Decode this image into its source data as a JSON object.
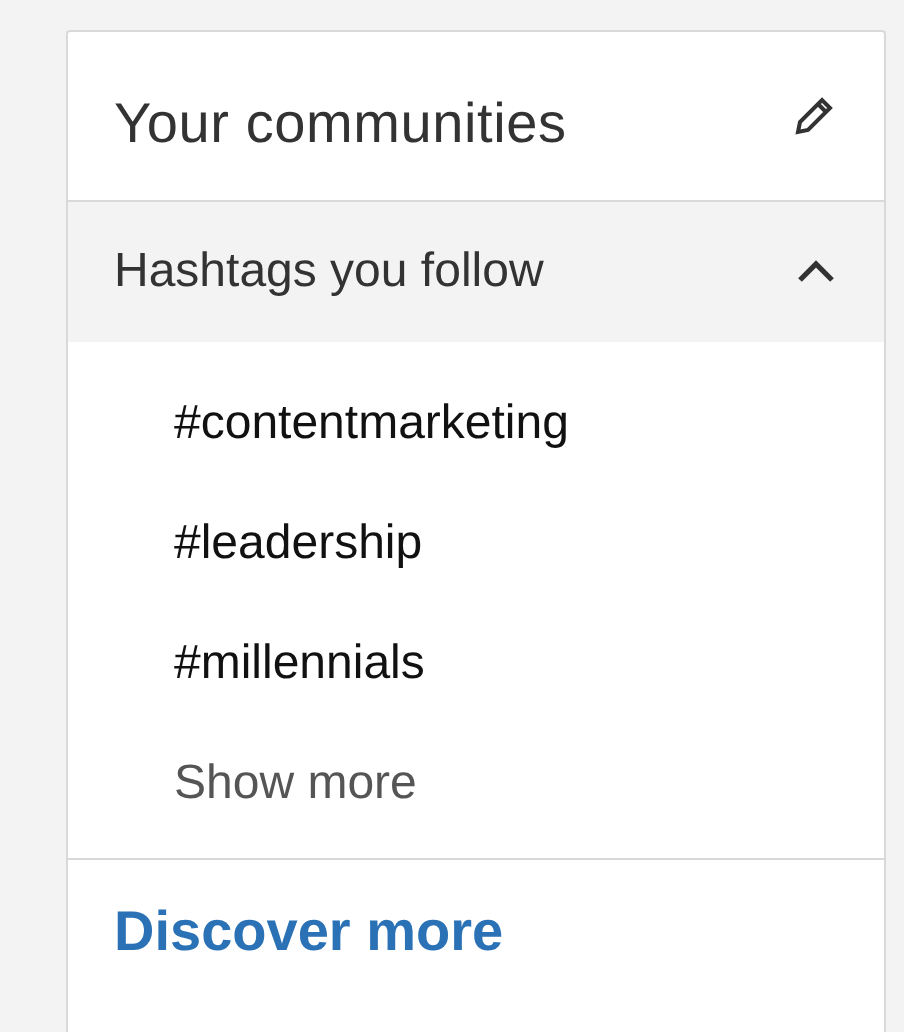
{
  "card": {
    "title": "Your communities"
  },
  "section": {
    "title": "Hashtags you follow",
    "expanded": true,
    "items": [
      {
        "label": "#contentmarketing"
      },
      {
        "label": "#leadership"
      },
      {
        "label": "#millennials"
      }
    ],
    "show_more": "Show more"
  },
  "footer_link": "Discover more"
}
